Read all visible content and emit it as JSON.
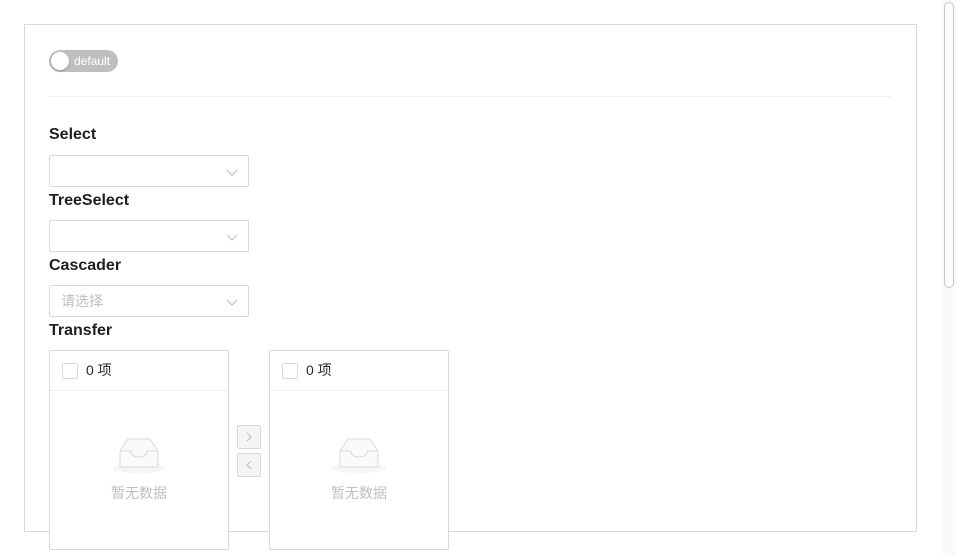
{
  "switch": {
    "label": "default",
    "checked": false
  },
  "select": {
    "label": "Select",
    "placeholder": "",
    "icon": "chevron-down-icon"
  },
  "tree_select": {
    "label": "TreeSelect",
    "placeholder": "",
    "icon": "chevron-down-icon"
  },
  "cascader": {
    "label": "Cascader",
    "placeholder": "请选择",
    "icon": "chevron-down-icon"
  },
  "transfer": {
    "label": "Transfer",
    "left": {
      "count": "0 项",
      "empty_text": "暂无数据"
    },
    "right": {
      "count": "0 项",
      "empty_text": "暂无数据"
    },
    "to_right_icon": "chevron-right-icon",
    "to_left_icon": "chevron-left-icon"
  },
  "colors": {
    "border": "#d9d9d9",
    "switch_off": "#bfbfbf",
    "placeholder": "#bfbfbf"
  }
}
